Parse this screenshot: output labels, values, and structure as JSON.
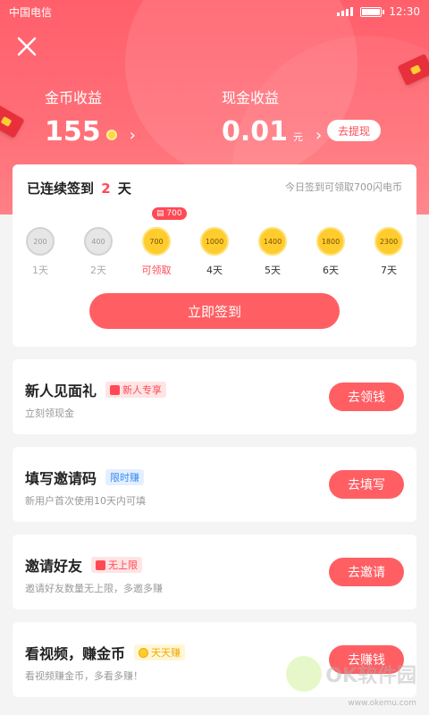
{
  "status_bar": {
    "carrier": "中国电信",
    "time": "12:30"
  },
  "header": {
    "coin_income": {
      "label": "金币收益",
      "value": "155"
    },
    "cash_income": {
      "label": "现金收益",
      "value": "0.01",
      "unit": "元"
    },
    "withdraw_label": "去提现"
  },
  "signin": {
    "title_prefix": "已连续签到",
    "days": "2",
    "title_suffix": "天",
    "hint": "今日签到可领取700闪电币",
    "today_badge": "700",
    "days_list": [
      {
        "coins": "200",
        "label": "1天"
      },
      {
        "coins": "400",
        "label": "2天"
      },
      {
        "coins": "700",
        "label": "可领取"
      },
      {
        "coins": "1000",
        "label": "4天"
      },
      {
        "coins": "1400",
        "label": "5天"
      },
      {
        "coins": "1800",
        "label": "6天"
      },
      {
        "coins": "2300",
        "label": "7天"
      }
    ],
    "button_label": "立即签到"
  },
  "tasks": [
    {
      "title": "新人见面礼",
      "tag": "新人专享",
      "subtitle": "立刻领现金",
      "button": "去领钱"
    },
    {
      "title": "填写邀请码",
      "tag": "限时赚",
      "subtitle": "新用户首次使用10天内可填",
      "button": "去填写"
    },
    {
      "title": "邀请好友",
      "tag": "无上限",
      "subtitle": "邀请好友数量无上限，多邀多赚",
      "button": "去邀请"
    },
    {
      "title": "看视频，赚金币",
      "tag": "天天赚",
      "subtitle": "看视频赚金币，多看多赚！",
      "button": "去赚钱"
    }
  ],
  "watermark": {
    "text": "OK软件园",
    "url": "www.okemu.com"
  }
}
